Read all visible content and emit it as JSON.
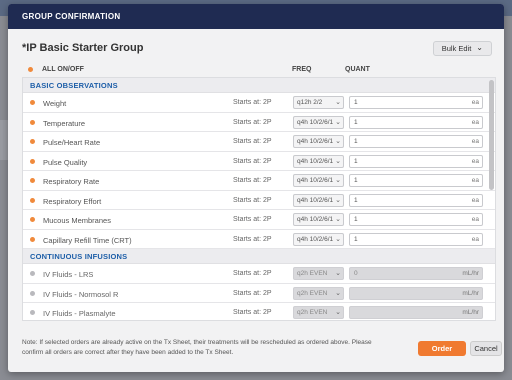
{
  "modal": {
    "header_title": "GROUP CONFIRMATION",
    "group_title": "*IP Basic Starter Group",
    "bulk_edit_label": "Bulk Edit",
    "bulk_edit_icon": "chevron-down-icon"
  },
  "columns": {
    "all_on_off": "ALL ON/OFF",
    "freq": "FREQ",
    "quant": "QUANT"
  },
  "colors": {
    "header_bg": "#1f2b52",
    "accent_orange": "#f07a30",
    "section_blue": "#1d5ea8"
  },
  "sections": [
    {
      "title": "BASIC OBSERVATIONS",
      "rows": [
        {
          "name": "Weight",
          "starts": "Starts at: 2P",
          "freq": "q12h 2/2",
          "quant": "1",
          "unit": "ea",
          "on": true
        },
        {
          "name": "Temperature",
          "starts": "Starts at: 2P",
          "freq": "q4h 10/2/6/1",
          "quant": "1",
          "unit": "ea",
          "on": true
        },
        {
          "name": "Pulse/Heart Rate",
          "starts": "Starts at: 2P",
          "freq": "q4h 10/2/6/1",
          "quant": "1",
          "unit": "ea",
          "on": true
        },
        {
          "name": "Pulse Quality",
          "starts": "Starts at: 2P",
          "freq": "q4h 10/2/6/1",
          "quant": "1",
          "unit": "ea",
          "on": true
        },
        {
          "name": "Respiratory Rate",
          "starts": "Starts at: 2P",
          "freq": "q4h 10/2/6/1",
          "quant": "1",
          "unit": "ea",
          "on": true
        },
        {
          "name": "Respiratory Effort",
          "starts": "Starts at: 2P",
          "freq": "q4h 10/2/6/1",
          "quant": "1",
          "unit": "ea",
          "on": true
        },
        {
          "name": "Mucous Membranes",
          "starts": "Starts at: 2P",
          "freq": "q4h 10/2/6/1",
          "quant": "1",
          "unit": "ea",
          "on": true
        },
        {
          "name": "Capillary Refill Time (CRT)",
          "starts": "Starts at: 2P",
          "freq": "q4h 10/2/6/1",
          "quant": "1",
          "unit": "ea",
          "on": true
        }
      ]
    },
    {
      "title": "CONTINUOUS INFUSIONS",
      "rows": [
        {
          "name": "IV Fluids - LRS",
          "starts": "Starts at: 2P",
          "freq": "q2h EVEN",
          "quant": "0",
          "unit": "mL/hr",
          "on": false
        },
        {
          "name": "IV Fluids - Normosol R",
          "starts": "Starts at: 2P",
          "freq": "q2h EVEN",
          "quant": "",
          "unit": "mL/hr",
          "on": false
        },
        {
          "name": "IV Fluids - Plasmalyte",
          "starts": "Starts at: 2P",
          "freq": "q2h EVEN",
          "quant": "",
          "unit": "mL/hr",
          "on": false
        }
      ]
    }
  ],
  "footer": {
    "note": "Note: If selected orders are already active on the Tx Sheet, their treatments will be rescheduled as ordered above. Please confirm all orders are correct after they have been added to the Tx Sheet.",
    "order_label": "Order",
    "cancel_label": "Cancel"
  }
}
